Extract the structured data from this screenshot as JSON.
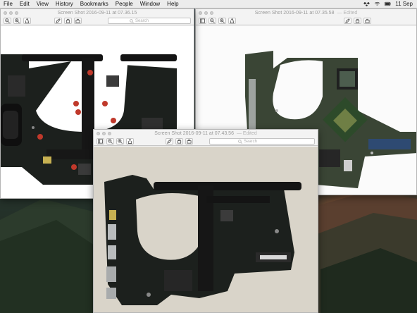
{
  "menubar": {
    "items": [
      "File",
      "Edit",
      "View",
      "History",
      "Bookmarks",
      "People",
      "Window",
      "Help"
    ],
    "date": "11 Sep"
  },
  "windows": [
    {
      "id": "w1",
      "title": "Screen Shot 2016-09-11 at 07.36.15",
      "edited": "",
      "search_placeholder": "Search"
    },
    {
      "id": "w2",
      "title": "Screen Shot 2016-09-11 at 07.35.58",
      "edited": "— Edited",
      "search_placeholder": "Search"
    },
    {
      "id": "w3",
      "title": "Screen Shot 2016-09-11 at 07.43.56",
      "edited": "— Edited",
      "search_placeholder": "Search"
    }
  ],
  "colors": {
    "board": "#1c201d",
    "heatsink": "#141414",
    "screw_highlight": "#c0392b",
    "wallpaper_sky": "#3f4c52",
    "photo_bg_window3": "#d9d4c9"
  },
  "icons": [
    "zoom-out-icon",
    "zoom-in-icon",
    "share-icon",
    "pen-icon",
    "rotate-icon",
    "toolbox-icon",
    "search-icon",
    "wifi-icon",
    "dropbox-icon",
    "battery-icon"
  ]
}
